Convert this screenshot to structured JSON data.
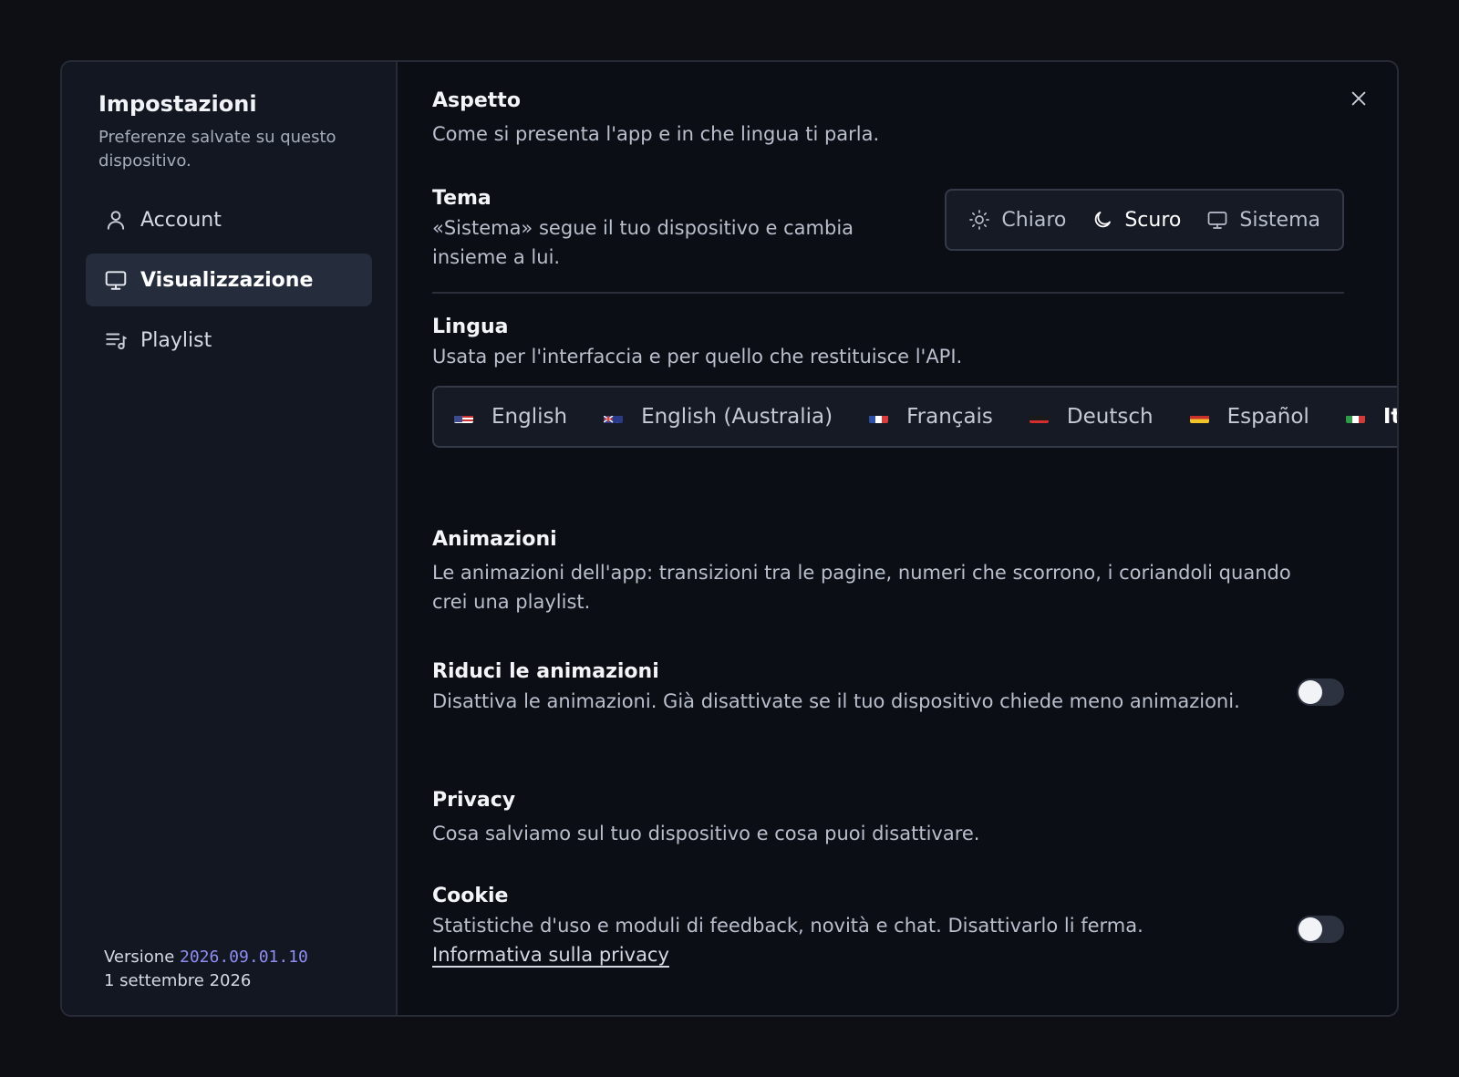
{
  "sidebar": {
    "title": "Impostazioni",
    "subtitle": "Preferenze salvate su questo dispositivo.",
    "items": [
      {
        "label": "Account",
        "icon": "user-icon"
      },
      {
        "label": "Visualizzazione",
        "icon": "monitor-icon",
        "active": true
      },
      {
        "label": "Playlist",
        "icon": "playlist-icon"
      }
    ],
    "version_label": "Versione",
    "version_number": "2026.09.01.10",
    "version_date": "1 settembre 2026"
  },
  "content": {
    "close_icon": "close-icon",
    "aspetto": {
      "title": "Aspetto",
      "desc": "Come si presenta l'app e in che lingua ti parla."
    },
    "tema": {
      "title": "Tema",
      "desc": "«Sistema» segue il tuo dispositivo e cambia insieme a lui.",
      "options": [
        {
          "label": "Chiaro",
          "icon": "sun-icon"
        },
        {
          "label": "Scuro",
          "icon": "moon-icon",
          "selected": true
        },
        {
          "label": "Sistema",
          "icon": "monitor-icon"
        }
      ]
    },
    "lingua": {
      "title": "Lingua",
      "desc": "Usata per l'interfaccia e per quello che restituisce l'API.",
      "languages": [
        {
          "label": "English",
          "flag": "us-flag"
        },
        {
          "label": "English (Australia)",
          "flag": "au-flag"
        },
        {
          "label": "Français",
          "flag": "fr-flag"
        },
        {
          "label": "Deutsch",
          "flag": "de-flag"
        },
        {
          "label": "Español",
          "flag": "es-flag"
        },
        {
          "label": "Italiano",
          "flag": "it-flag",
          "current": true
        }
      ]
    },
    "animazioni": {
      "title": "Animazioni",
      "desc": "Le animazioni dell'app: transizioni tra le pagine, numeri che scorrono, i coriandoli quando crei una playlist.",
      "riduci_title": "Riduci le animazioni",
      "riduci_desc": "Disattiva le animazioni. Già disattivate se il tuo dispositivo chiede meno animazioni.",
      "riduci_on": false
    },
    "privacy": {
      "title": "Privacy",
      "desc": "Cosa salviamo sul tuo dispositivo e cosa puoi disattivare.",
      "cookie_title": "Cookie",
      "cookie_desc": "Statistiche d'uso e moduli di feedback, novità e chat. Disattivarlo li ferma.",
      "cookie_link": "Informativa sulla privacy",
      "cookie_on": false
    }
  }
}
